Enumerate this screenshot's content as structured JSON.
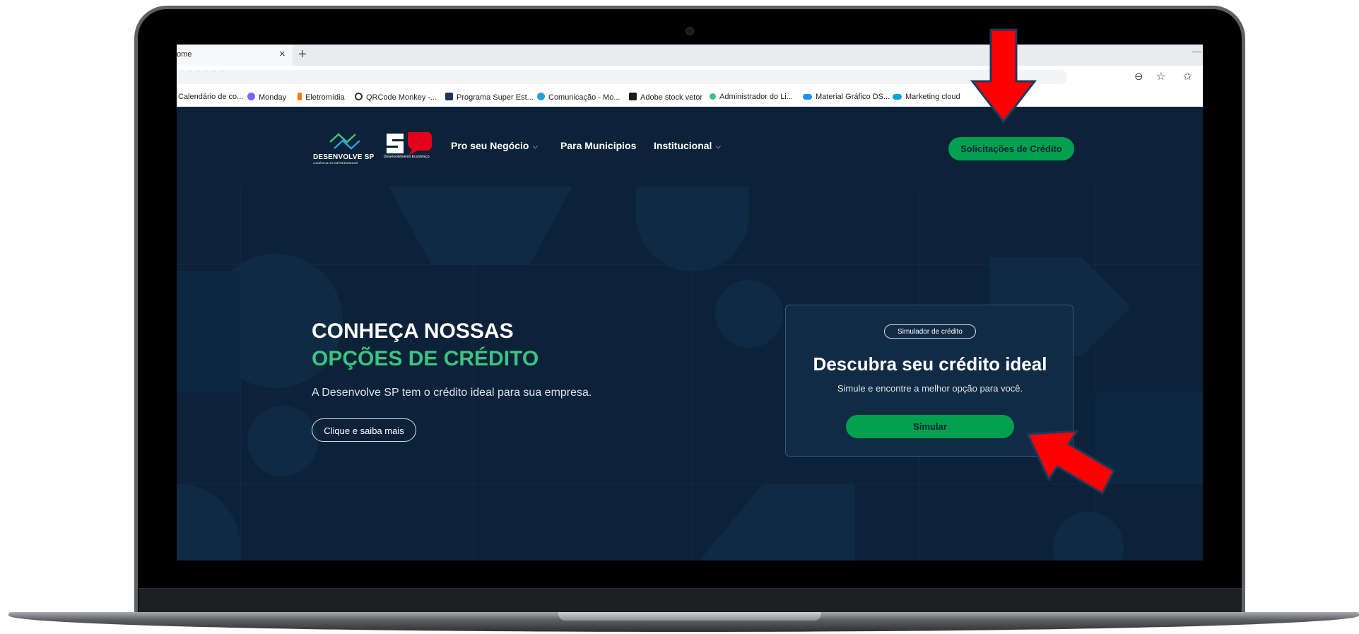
{
  "browser": {
    "tab_title": "ome",
    "close_glyph": "×",
    "new_tab_glyph": "+",
    "minimize_glyph": "—",
    "address_icons": [
      "⊖",
      "☆",
      "✩"
    ],
    "bookmarks": [
      {
        "label": "Calendário de co...",
        "icon": "calendar-icon",
        "color": ""
      },
      {
        "label": "Monday",
        "icon": "monday-icon",
        "color": "#7b61ff"
      },
      {
        "label": "Eletromídia",
        "icon": "eletromidia-icon",
        "color": "#ff7a00"
      },
      {
        "label": "QRCode Monkey -...",
        "icon": "qrcode-icon",
        "color": "#333333"
      },
      {
        "label": "Programa Super Est...",
        "icon": "programa-icon",
        "color": "#1d3557"
      },
      {
        "label": "Comunicação - Mo...",
        "icon": "comunicacao-icon",
        "color": "#2b9ed8"
      },
      {
        "label": "Adobe stock vetor",
        "icon": "adobe-stock-icon",
        "color": "#1a1a1a"
      },
      {
        "label": "Administrador do Li...",
        "icon": "admin-icon",
        "color": "#3ec27f"
      },
      {
        "label": "Material Gráfico DS...",
        "icon": "cloud-icon",
        "color": "#1e90ff"
      },
      {
        "label": "Marketing cloud",
        "icon": "salesforce-icon",
        "color": "#00a1e0"
      }
    ]
  },
  "site": {
    "logo_text": "DESENVOLVE SP",
    "logo_sub": "A AGÊNCIA DO EMPREENDEDOR",
    "sp_sub": "Desenvolvimento Econômico",
    "nav": {
      "item1": "Pro seu Negócio",
      "item2": "Para Municipios",
      "item3": "Institucional",
      "chevron": "⌵"
    },
    "cta_top": "Solicitações de Crédito",
    "hero": {
      "heading_line1": "CONHEÇA NOSSAS",
      "heading_line2": "OPÇÕES DE CRÉDITO",
      "subtitle": "A Desenvolve SP tem o crédito ideal para sua empresa.",
      "button": "Clique e saiba mais"
    },
    "card": {
      "badge": "Simulador de crédito",
      "title": "Descubra seu crédito ideal",
      "text": "Simule e encontre a melhor opção para você.",
      "button": "Simular"
    }
  },
  "colors": {
    "background": "#0b2238",
    "accent_green": "#00a04e",
    "heading_green": "#3ec27f",
    "annotation_red": "#ff0000"
  }
}
